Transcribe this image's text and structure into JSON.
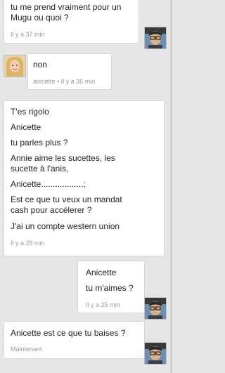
{
  "messages": [
    {
      "lines": [
        "tu me prend vraiment pour un",
        "Mugu ou quoi ?"
      ],
      "time": "Il y a 37 min"
    },
    {
      "lines": [
        "non"
      ],
      "time": "anicette • Il y a 36 min"
    },
    {
      "lines": [
        "T'es rigolo",
        "Anicette",
        "tu parles plus ?",
        "Annie aime les sucettes, les",
        "sucette à l'anis,",
        "Anicette..................;",
        "Est ce que tu veux un mandat",
        "cash pour accélerer ?",
        "J'ai un compte western union"
      ],
      "time": "Il y a 28 min"
    },
    {
      "lines": [
        "Anicette",
        "tu m'aimes ?"
      ],
      "time": "Il y a 25 min"
    },
    {
      "lines": [
        "Anicette est ce que tu baises ?"
      ],
      "time": "Maintenant"
    }
  ]
}
